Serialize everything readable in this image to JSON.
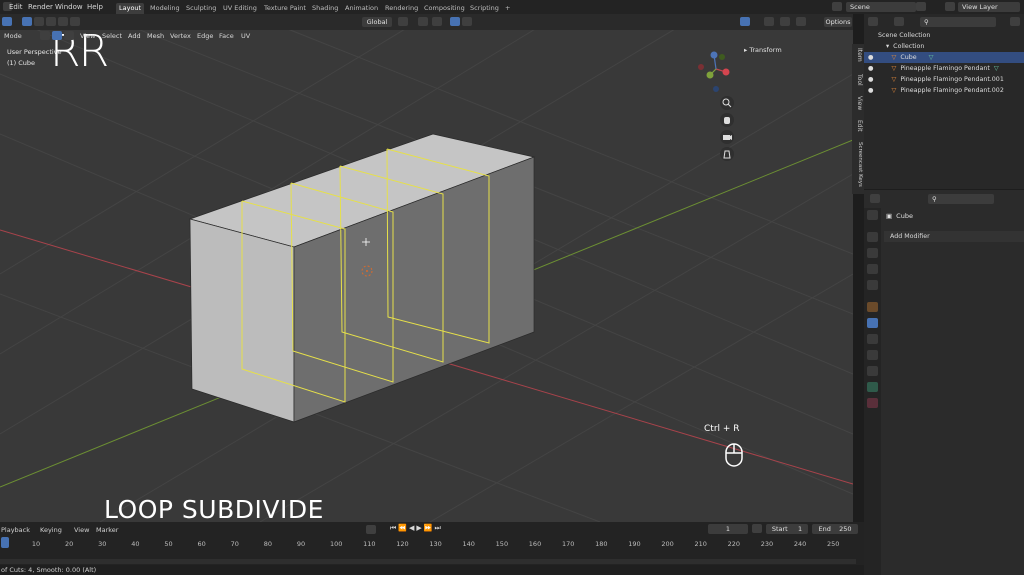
{
  "top_menu": [
    "Edit",
    "Render",
    "Window",
    "Help"
  ],
  "workspaces": [
    "Layout",
    "Modeling",
    "Sculpting",
    "UV Editing",
    "Texture Paint",
    "Shading",
    "Animation",
    "Rendering",
    "Compositing",
    "Scripting"
  ],
  "active_workspace": "Layout",
  "add_workspace": "+",
  "scene_name": "Scene",
  "view_layer": "View Layer",
  "viewport_header": {
    "mode": "Mode",
    "menus": [
      "View",
      "Select",
      "Add",
      "Mesh",
      "Vertex",
      "Edge",
      "Face",
      "UV"
    ],
    "orientation": "Global",
    "options": "Options"
  },
  "viewport": {
    "perspective_label": "User Perspective",
    "object_label": "(1) Cube",
    "transform_panel": "Transform",
    "overlay_title": "LOOP SUBDIVIDE",
    "shortcut": "Ctrl + R",
    "watermark": "RR"
  },
  "side_tabs": [
    "Item",
    "Tool",
    "View",
    "Edit",
    "Screencast Keys"
  ],
  "outliner": {
    "items": [
      {
        "label": "Scene Collection",
        "level": 0,
        "selected": false
      },
      {
        "label": "Collection",
        "level": 1,
        "selected": false
      },
      {
        "label": "Cube",
        "level": 2,
        "selected": true
      },
      {
        "label": "Pineapple Flamingo Pendant",
        "level": 2,
        "selected": false
      },
      {
        "label": "Pineapple Flamingo Pendant.001",
        "level": 2,
        "selected": false
      },
      {
        "label": "Pineapple Flamingo Pendant.002",
        "level": 2,
        "selected": false
      }
    ]
  },
  "properties": {
    "object_name": "Cube",
    "add_modifier": "Add Modifier"
  },
  "timeline": {
    "menus": [
      "Playback",
      "Keying",
      "View",
      "Marker"
    ],
    "current_frame": "1",
    "start_label": "Start",
    "start_value": "1",
    "end_label": "End",
    "end_value": "250",
    "ruler_marks": [
      "1",
      "10",
      "20",
      "30",
      "40",
      "50",
      "60",
      "70",
      "80",
      "90",
      "100",
      "110",
      "120",
      "130",
      "140",
      "150",
      "160",
      "170",
      "180",
      "190",
      "200",
      "210",
      "220",
      "230",
      "240",
      "250"
    ]
  },
  "status_text": "of Cuts: 4, Smooth: 0.00 (Alt)",
  "colors": {
    "accent": "#4772b3",
    "viewport_bg": "#393939",
    "edge_loop": "#e6e04a",
    "x_axis": "#c0454f",
    "y_axis": "#7fa23b",
    "playhead": "#4772b3"
  }
}
